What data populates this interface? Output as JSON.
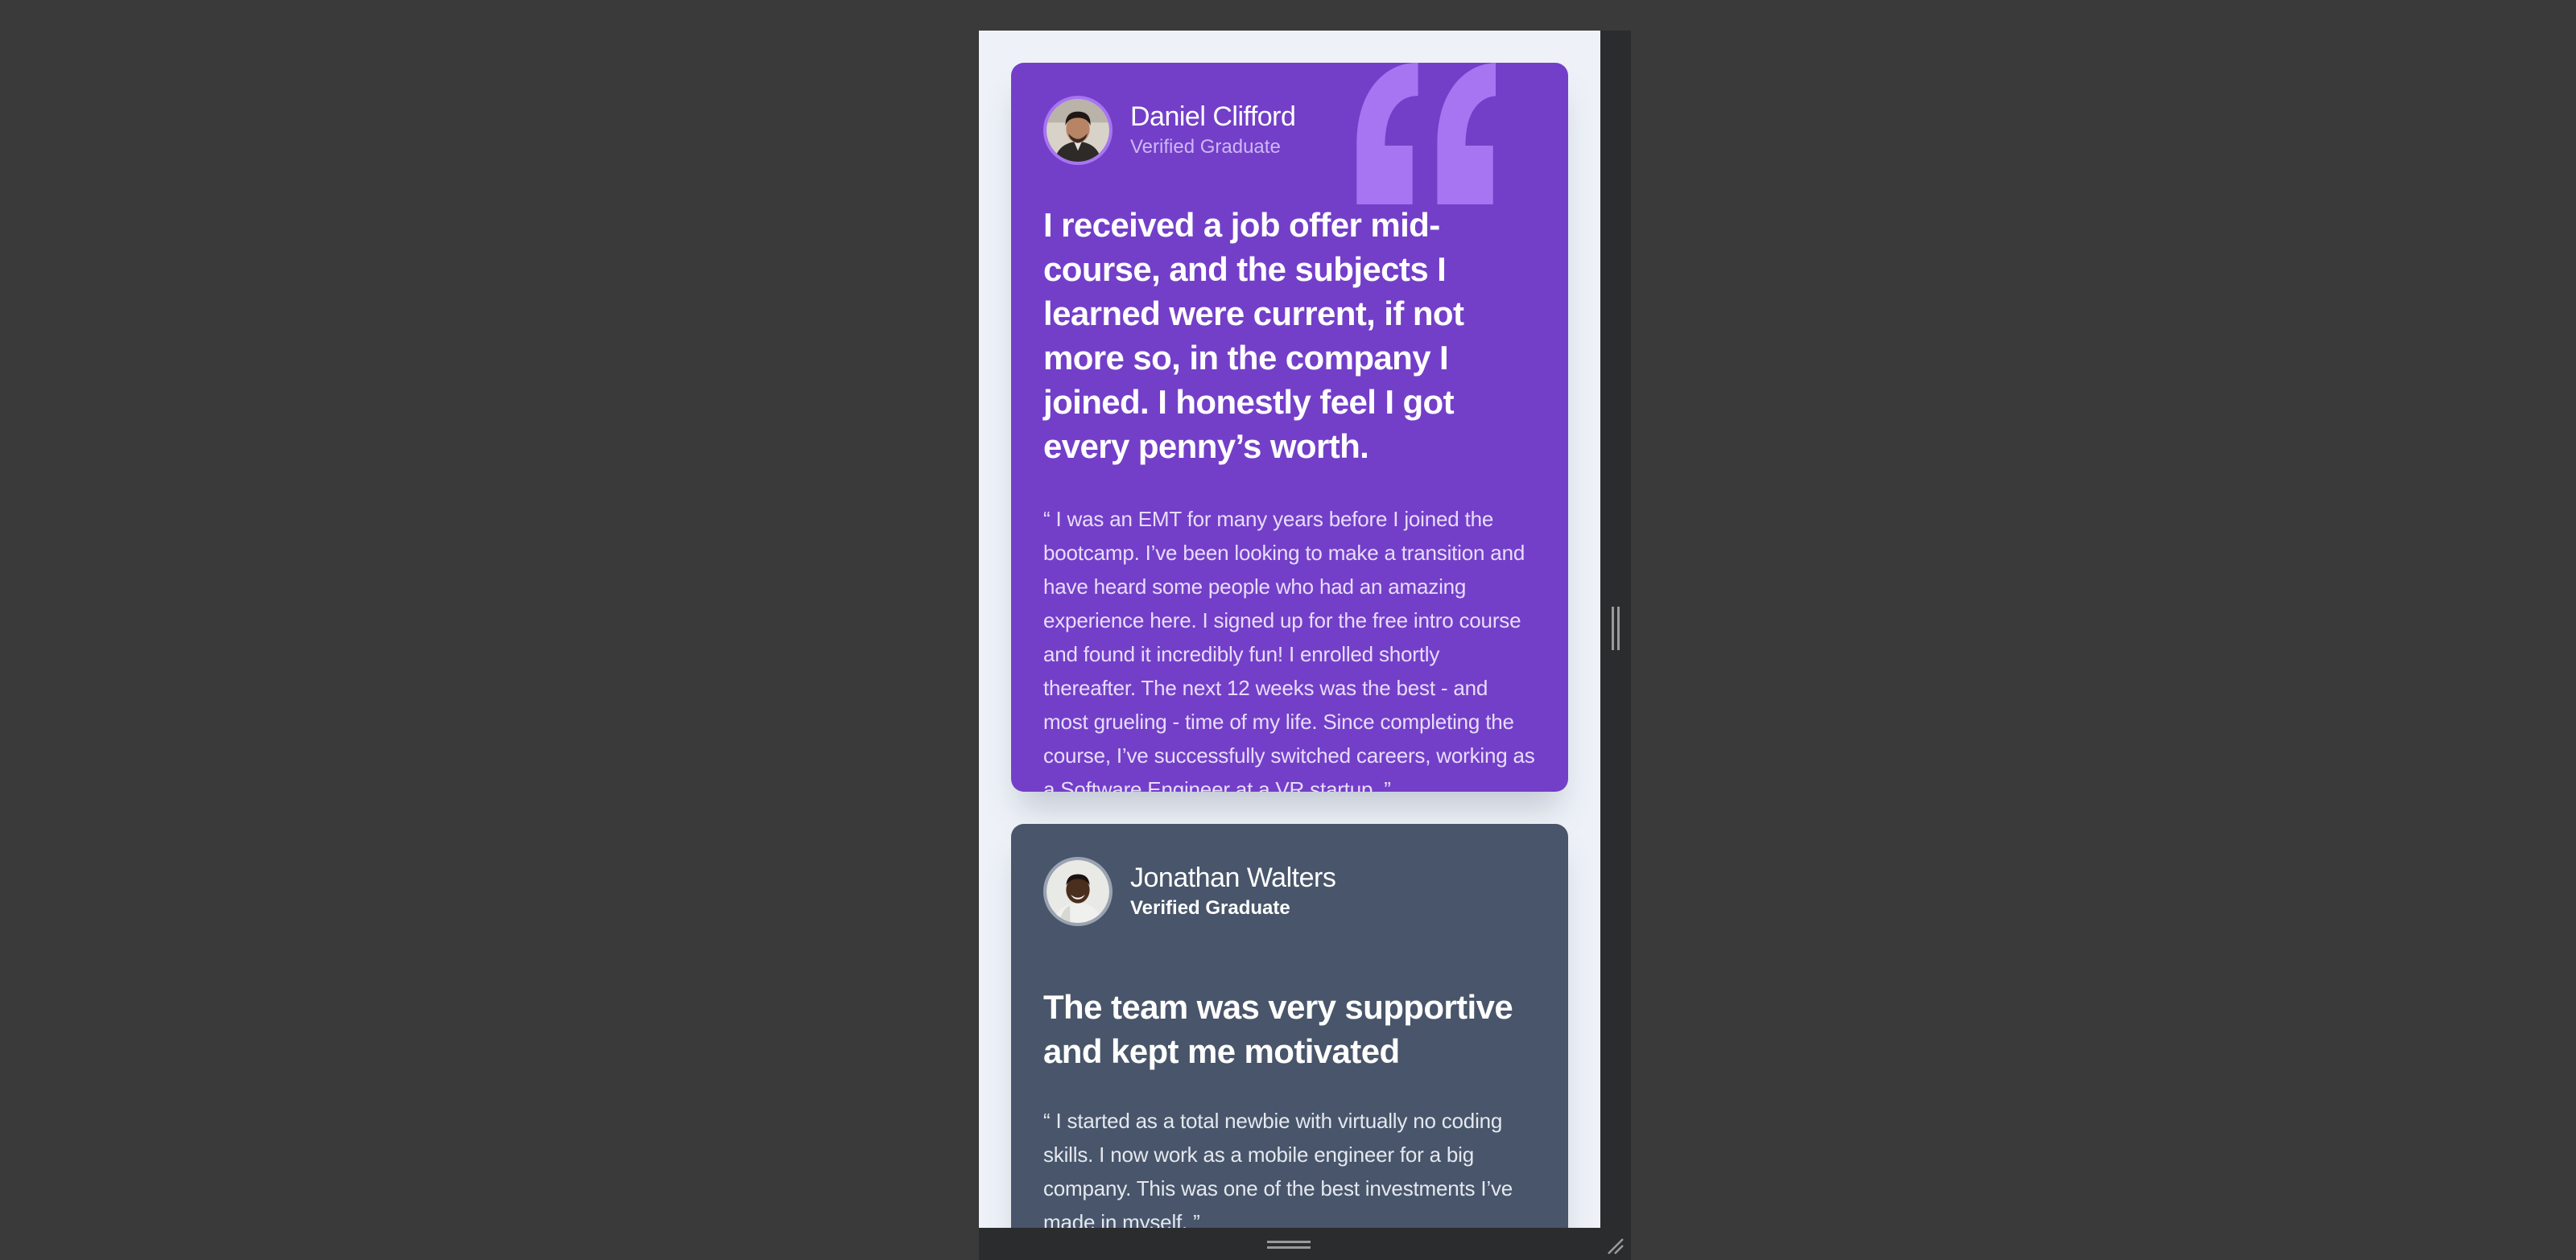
{
  "testimonials": [
    {
      "name": "Daniel Clifford",
      "role": "Verified Graduate",
      "headline": "I received a job offer mid-course, and the subjects I learned were current, if not more so, in the company I joined. I honestly feel I got every penny’s worth.",
      "body": "“ I was an EMT for many years before I joined the bootcamp. I’ve been looking to make a transition and have heard some people who had an amazing experience here. I signed up for the free intro course and found it incredibly fun! I enrolled shortly thereafter. The next 12 weeks was the best - and most grueling - time of my life. Since completing the course, I’ve successfully switched careers, working as a Software Engineer at a VR startup. ”",
      "card_color": "#733fc8"
    },
    {
      "name": "Jonathan Walters",
      "role": "Verified Graduate",
      "headline": "The team was very supportive and kept me motivated",
      "body": "“ I started as a total newbie with virtually no coding skills. I now work as a mobile engineer for a big company. This was one of the best investments I’ve made in myself. ”",
      "card_color": "#48556a"
    }
  ],
  "icons": {
    "quote": "quote-mark-icon",
    "resize_vertical": "resize-grip-icon",
    "resize_horizontal": "resize-grip-icon",
    "resize_corner": "resize-corner-icon"
  }
}
